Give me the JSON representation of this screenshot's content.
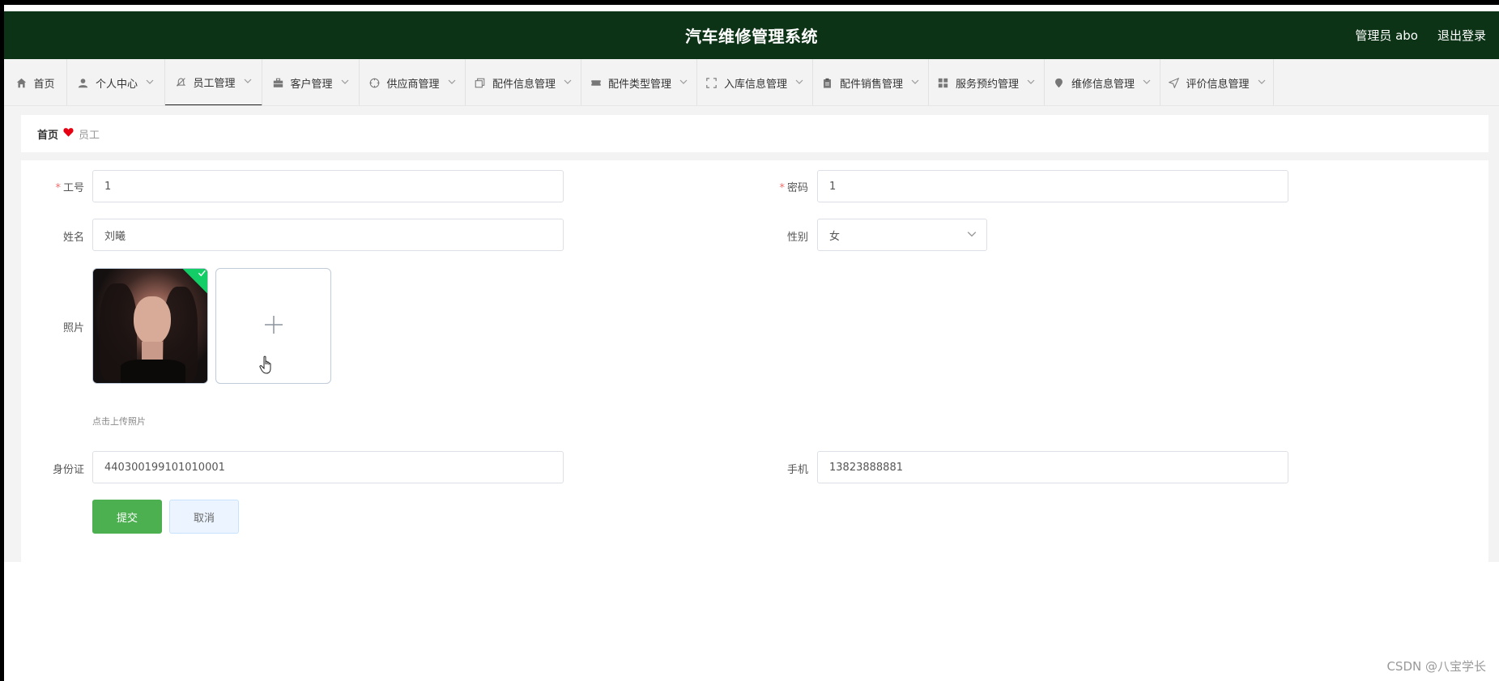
{
  "header": {
    "title": "汽车维修管理系统",
    "user": "管理员 abo",
    "logout": "退出登录",
    "bg_color": "#0c3316"
  },
  "nav": {
    "items": [
      {
        "label": "首页",
        "icon": "home-icon",
        "has_arrow": false
      },
      {
        "label": "个人中心",
        "icon": "user-icon",
        "has_arrow": true
      },
      {
        "label": "员工管理",
        "icon": "bell-off-icon",
        "has_arrow": true,
        "active": true
      },
      {
        "label": "客户管理",
        "icon": "briefcase-icon",
        "has_arrow": true
      },
      {
        "label": "供应商管理",
        "icon": "compass-icon",
        "has_arrow": true
      },
      {
        "label": "配件信息管理",
        "icon": "copy-icon",
        "has_arrow": true
      },
      {
        "label": "配件类型管理",
        "icon": "ticket-icon",
        "has_arrow": true
      },
      {
        "label": "入库信息管理",
        "icon": "fullscreen-icon",
        "has_arrow": true
      },
      {
        "label": "配件销售管理",
        "icon": "clipboard-icon",
        "has_arrow": true
      },
      {
        "label": "服务预约管理",
        "icon": "grid-icon",
        "has_arrow": true
      },
      {
        "label": "维修信息管理",
        "icon": "pin-icon",
        "has_arrow": true
      },
      {
        "label": "评价信息管理",
        "icon": "send-icon",
        "has_arrow": true
      }
    ]
  },
  "breadcrumb": {
    "home": "首页",
    "current": "员工"
  },
  "form": {
    "employee_no_label": "工号",
    "employee_no_value": "1",
    "password_label": "密码",
    "password_value": "1",
    "name_label": "姓名",
    "name_value": "刘曦",
    "gender_label": "性别",
    "gender_value": "女",
    "photo_label": "照片",
    "photo_hint": "点击上传照片",
    "id_label": "身份证",
    "id_value": "440300199101010001",
    "phone_label": "手机",
    "phone_value": "13823888881",
    "submit_label": "提交",
    "cancel_label": "取消"
  },
  "watermark": "CSDN @八宝学长",
  "colors": {
    "primary_button": "#4caf50",
    "required_star": "#f56c6c",
    "breadcrumb_heart": "#e60012"
  }
}
